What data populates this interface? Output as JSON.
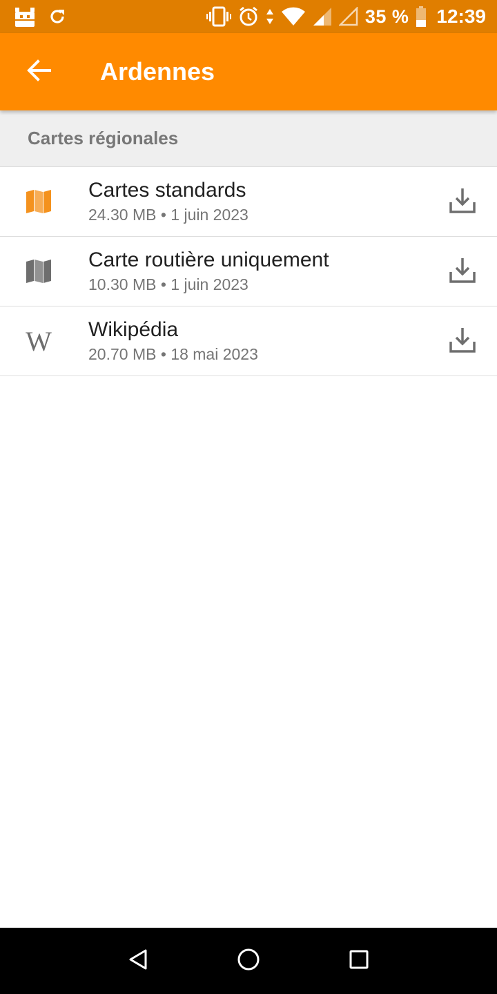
{
  "status_bar": {
    "battery_percent": "35 %",
    "time": "12:39",
    "icons": [
      "app-notification-icon",
      "sync-icon",
      "vibrate-icon",
      "alarm-icon",
      "data-arrows-icon",
      "wifi-icon",
      "signal-icon",
      "signal-empty-icon",
      "battery-icon"
    ]
  },
  "app_bar": {
    "title": "Ardennes",
    "back_icon": "arrow-back-icon"
  },
  "section": {
    "title": "Cartes régionales"
  },
  "items": [
    {
      "title": "Cartes standards",
      "subtitle": "24.30 MB • 1 juin 2023",
      "icon": "map-icon",
      "icon_color": "#F4921E",
      "action_icon": "download-icon"
    },
    {
      "title": "Carte routière uniquement",
      "subtitle": "10.30 MB • 1 juin 2023",
      "icon": "map-icon",
      "icon_color": "#6E6E6E",
      "action_icon": "download-icon"
    },
    {
      "title": "Wikipédia",
      "subtitle": "20.70 MB • 18 mai 2023",
      "icon": "wikipedia-icon",
      "icon_color": "#6E6E6E",
      "action_icon": "download-icon"
    }
  ],
  "nav_bar": {
    "icons": [
      "back-triangle-icon",
      "home-circle-icon",
      "recents-square-icon"
    ]
  },
  "colors": {
    "status_bar": "#E07E00",
    "app_bar": "#FF8A00",
    "section_bg": "#EFEFEF"
  }
}
